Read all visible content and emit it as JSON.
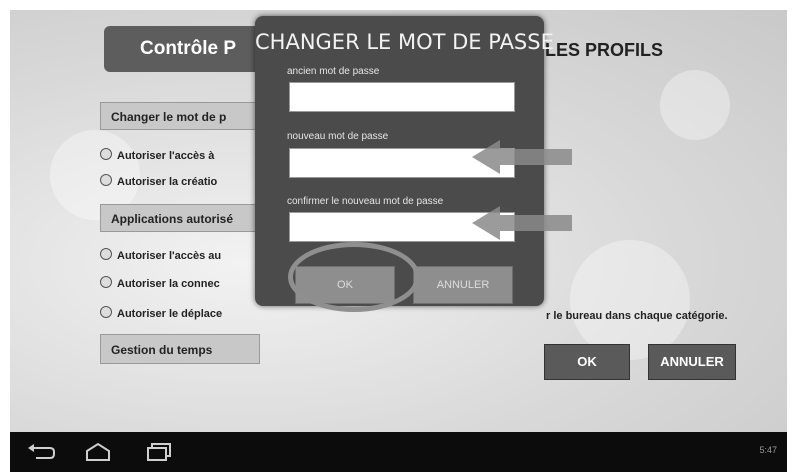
{
  "main": {
    "title_partial": "Contrôle P",
    "profils_title": "LES PROFILS",
    "sections": {
      "password_label": "Changer le mot de p",
      "apps_label": "Applications autorisé",
      "time_label": "Gestion du temps"
    },
    "options": [
      "Autoriser l'accès à",
      "Autoriser la créatio",
      "Autoriser l'accès au",
      "Autoriser la connec",
      "Autoriser le déplace"
    ],
    "description_partial": "r le bureau dans chaque catégorie.",
    "ok_label": "OK",
    "cancel_label": "ANNULER"
  },
  "dialog": {
    "title": "CHANGER LE MOT DE PASSE",
    "fields": [
      {
        "label": "ancien mot de passe",
        "value": ""
      },
      {
        "label": "nouveau mot de passe",
        "value": ""
      },
      {
        "label": "confirmer le nouveau mot de passe",
        "value": ""
      }
    ],
    "ok_label": "OK",
    "cancel_label": "ANNULER"
  },
  "status_bar": {
    "time": "5:47"
  },
  "icons": [
    "back-icon",
    "home-icon",
    "recent-apps-icon",
    "radio-icon",
    "arrow-icon"
  ],
  "colors": {
    "dialog_bg": "#4b4b4b",
    "button_dark": "#5a5a5a",
    "navbar": "#0c0c0c",
    "highlight_circle": "#8f8f8f"
  }
}
